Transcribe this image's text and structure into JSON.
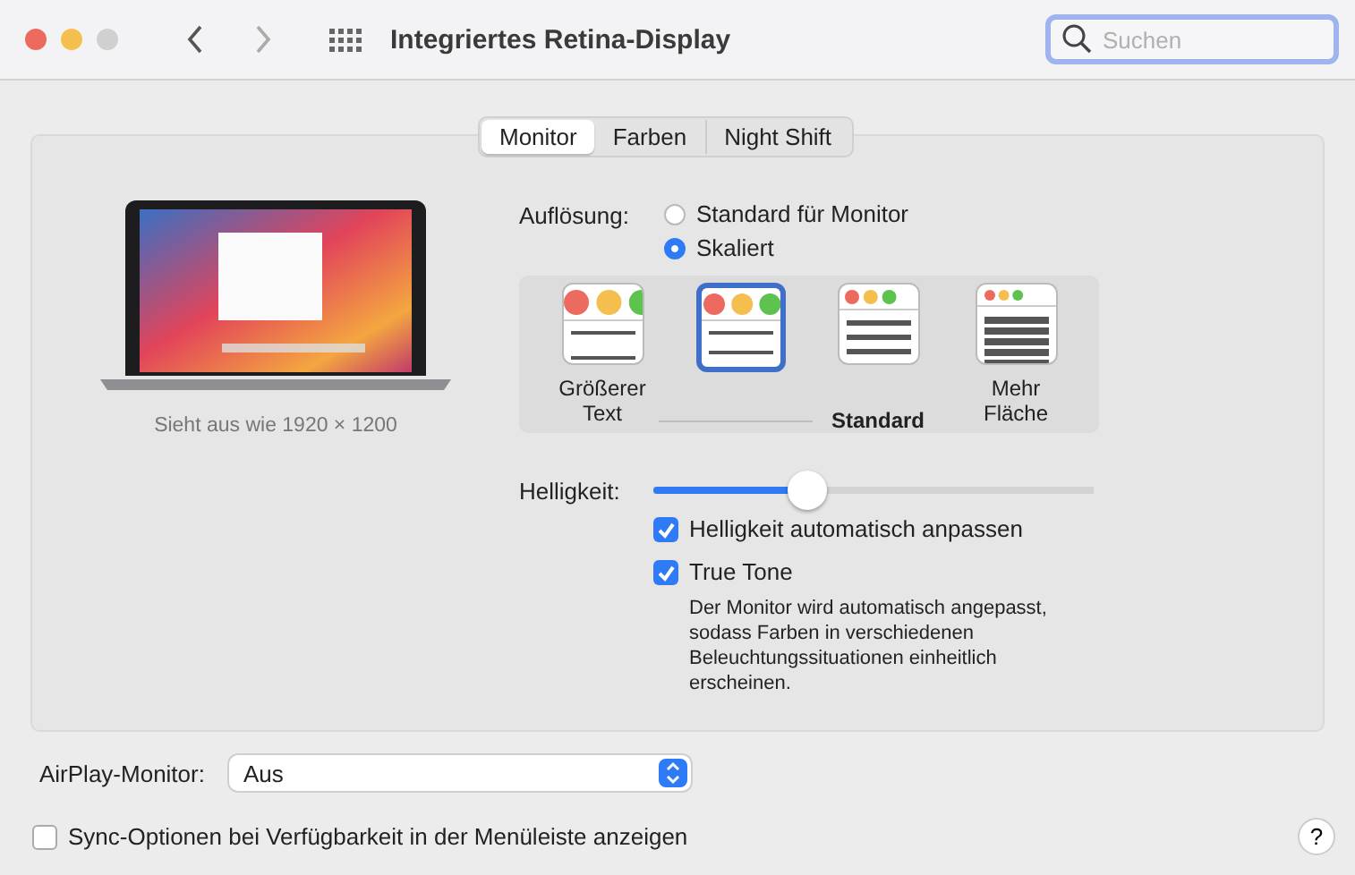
{
  "window": {
    "title": "Integriertes Retina-Display"
  },
  "search": {
    "placeholder": "Suchen"
  },
  "tabs": [
    {
      "label": "Monitor",
      "selected": true
    },
    {
      "label": "Farben",
      "selected": false
    },
    {
      "label": "Night Shift",
      "selected": false
    }
  ],
  "preview": {
    "caption": "Sieht aus wie 1920 × 1200"
  },
  "resolution": {
    "label": "Auflösung:",
    "options": [
      {
        "label": "Standard für Monitor",
        "selected": false
      },
      {
        "label": "Skaliert",
        "selected": true
      }
    ]
  },
  "scaling": [
    {
      "label": "Größerer Text",
      "selected": false,
      "kind": "option"
    },
    {
      "selected": true,
      "kind": "option"
    },
    {
      "label": "Standard",
      "selected": false,
      "kind": "default"
    },
    {
      "label": "Mehr Fläche",
      "selected": false,
      "kind": "option"
    }
  ],
  "brightness": {
    "label": "Helligkeit:",
    "level": 0.36
  },
  "options": [
    {
      "label": "Helligkeit automatisch anpassen",
      "checked": true
    },
    {
      "label": "True Tone",
      "checked": true
    }
  ],
  "true_tone_note": "Der Monitor wird automatisch angepasst, sodass Farben in verschiedenen Beleuchtungssituationen einheitlich erscheinen.",
  "airplay": {
    "label": "AirPlay-Monitor:",
    "value": "Aus"
  },
  "sync": {
    "label": "Sync-Optionen bei Verfügbarkeit in der Menüleiste anzeigen",
    "checked": false
  },
  "help": "?"
}
